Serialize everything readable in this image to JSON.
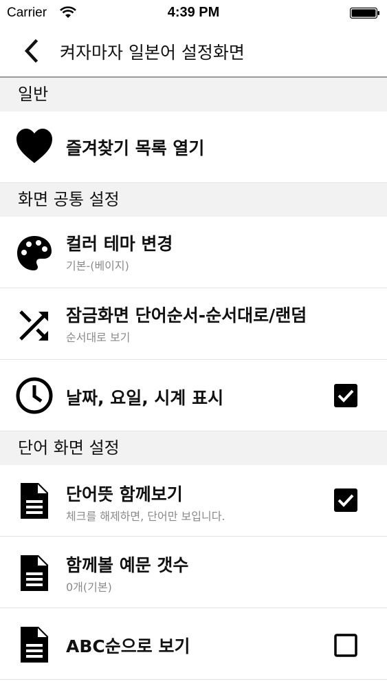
{
  "status_bar": {
    "carrier": "Carrier",
    "time": "4:39 PM"
  },
  "nav": {
    "title": "켜자마자 일본어 설정화면"
  },
  "sections": {
    "general": "일반",
    "screen_common": "화면 공통 설정",
    "word_screen": "단어 화면 설정"
  },
  "rows": {
    "favorites": {
      "label": "즐겨찾기 목록 열기"
    },
    "color_theme": {
      "label": "컬러 테마 변경",
      "sub": "기본-(베이지)"
    },
    "lock_order": {
      "label": "잠금화면 단어순서-순서대로/랜덤",
      "sub": "순서대로 보기"
    },
    "datetime": {
      "label": "날짜, 요일, 시계 표시",
      "checked": true
    },
    "meaning": {
      "label": "단어뜻 함께보기",
      "sub": "체크를 해제하면, 단어만 보입니다.",
      "checked": true
    },
    "examples": {
      "label": "함께볼 예문 갯수",
      "sub": "0개(기본)"
    },
    "abc_order": {
      "label": "ABC순으로 보기",
      "checked": false
    }
  }
}
